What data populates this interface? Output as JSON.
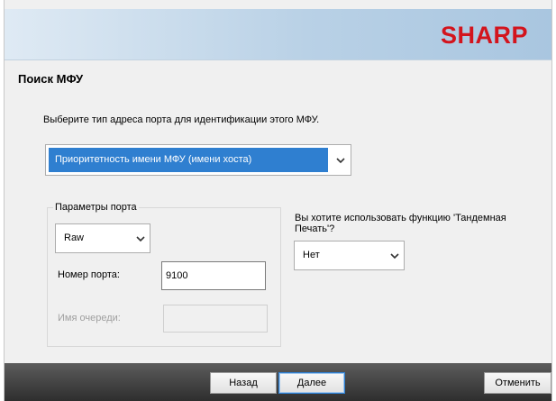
{
  "header": {
    "brand": "SHARP",
    "brand_color": "#d3141d"
  },
  "page": {
    "title": "Поиск МФУ"
  },
  "address": {
    "instruction": "Выберите тип адреса порта для идентификации этого МФУ.",
    "selected": "Приоритетность имени МФУ (имени хоста)"
  },
  "port_params": {
    "legend": "Параметры порта",
    "protocol": "Raw",
    "port_label": "Номер порта:",
    "port_value": "9100",
    "queue_label": "Имя очереди:",
    "queue_value": ""
  },
  "tandem": {
    "question": "Вы хотите использовать функцию 'Тандемная Печать'?",
    "selected": "Нет"
  },
  "footer": {
    "back_label": "Назад",
    "next_label": "Далее",
    "cancel_label": "Отменить"
  },
  "colors": {
    "selection": "#2f7fd0",
    "footer": "#3a3a3a"
  }
}
